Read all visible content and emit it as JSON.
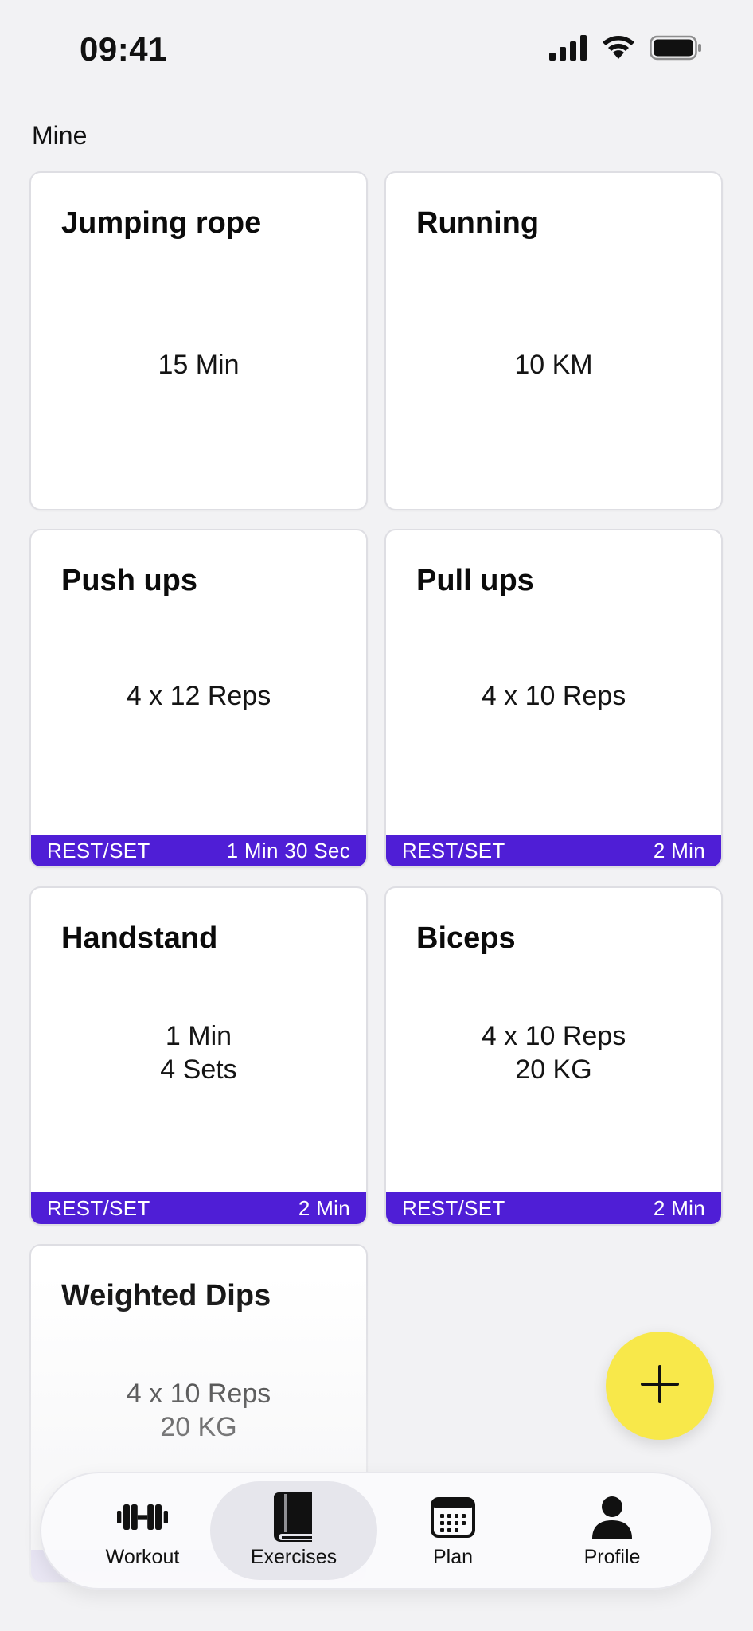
{
  "status_bar": {
    "time": "09:41"
  },
  "section": {
    "label": "Mine"
  },
  "cards": [
    {
      "title": "Jumping rope",
      "lines": [
        "15 Min"
      ],
      "rest_label": null,
      "rest_value": null
    },
    {
      "title": "Running",
      "lines": [
        "10 KM"
      ],
      "rest_label": null,
      "rest_value": null
    },
    {
      "title": "Push ups",
      "lines": [
        "4 x 12 Reps"
      ],
      "rest_label": "REST/SET",
      "rest_value": "1 Min 30 Sec"
    },
    {
      "title": "Pull ups",
      "lines": [
        "4 x 10 Reps"
      ],
      "rest_label": "REST/SET",
      "rest_value": "2 Min"
    },
    {
      "title": "Handstand",
      "lines": [
        "1 Min",
        "4 Sets"
      ],
      "rest_label": "REST/SET",
      "rest_value": "2 Min"
    },
    {
      "title": "Biceps",
      "lines": [
        "4 x 10 Reps",
        "20 KG"
      ],
      "rest_label": "REST/SET",
      "rest_value": "2 Min"
    },
    {
      "title": "Weighted Dips",
      "lines": [
        "4 x 10 Reps",
        "20 KG"
      ],
      "rest_label": null,
      "rest_value": null
    }
  ],
  "fab": {
    "icon": "plus-icon"
  },
  "tab_bar": {
    "tabs": [
      {
        "label": "Workout",
        "icon": "dumbbell-icon",
        "active": false
      },
      {
        "label": "Exercises",
        "icon": "book-icon",
        "active": true
      },
      {
        "label": "Plan",
        "icon": "calendar-icon",
        "active": false
      },
      {
        "label": "Profile",
        "icon": "person-icon",
        "active": false
      }
    ]
  },
  "colors": {
    "background": "#f2f2f4",
    "accent": "#4f1ed6",
    "fab": "#f8e84a",
    "card": "#ffffff"
  }
}
